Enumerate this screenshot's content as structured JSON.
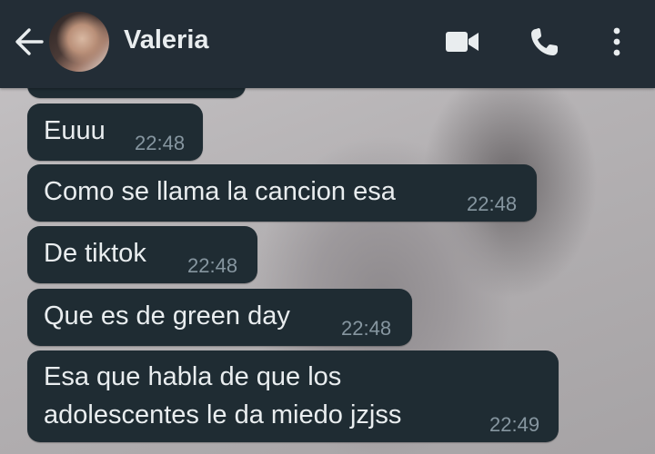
{
  "header": {
    "contact_name": "Valeria",
    "icons": [
      "back-arrow-icon",
      "avatar",
      "video-call-icon",
      "voice-call-icon",
      "more-options-icon"
    ]
  },
  "messages": [
    {
      "text": "",
      "time": ""
    },
    {
      "text": "Euuu",
      "time": "22:48"
    },
    {
      "text": "Como se llama la cancion esa",
      "time": "22:48"
    },
    {
      "text": "De tiktok",
      "time": "22:48"
    },
    {
      "text": "Que es de green day",
      "time": "22:48"
    },
    {
      "text": "Esa que habla de que los\nadolescentes le da miedo jzjss",
      "time": "22:49"
    }
  ],
  "colors": {
    "header_bg": "#232d36",
    "bubble_bg": "#1f2c33",
    "text": "#e9edef",
    "timestamp": "#8696a0"
  }
}
